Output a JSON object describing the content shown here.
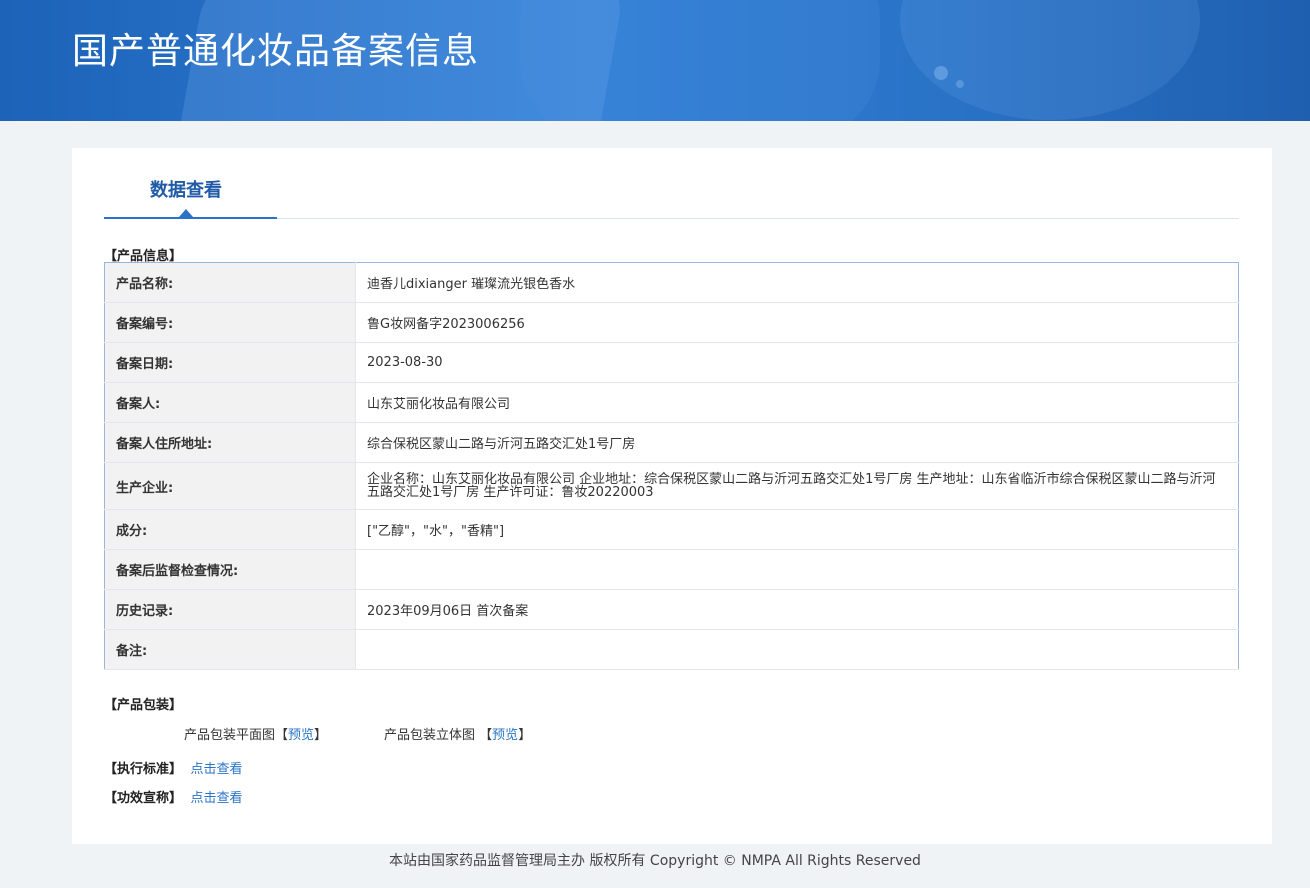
{
  "banner": {
    "title": "国产普通化妆品备案信息"
  },
  "tabs": [
    {
      "label": "数据查看"
    }
  ],
  "product_info": {
    "section_label": "【产品信息】",
    "rows": [
      {
        "key": "产品名称:",
        "value": "迪香儿dixianger 璀璨流光银色香水"
      },
      {
        "key": "备案编号:",
        "value": "鲁G妆网备字2023006256"
      },
      {
        "key": "备案日期:",
        "value": "2023-08-30"
      },
      {
        "key": "备案人:",
        "value": "山东艾丽化妆品有限公司"
      },
      {
        "key": "备案人住所地址:",
        "value": "综合保税区蒙山二路与沂河五路交汇处1号厂房"
      },
      {
        "key": "生产企业:",
        "value": "企业名称：山东艾丽化妆品有限公司 企业地址：综合保税区蒙山二路与沂河五路交汇处1号厂房 生产地址：山东省临沂市综合保税区蒙山二路与沂河五路交汇处1号厂房 生产许可证：鲁妆20220003"
      },
      {
        "key": "成分:",
        "value": "[\"乙醇\"，\"水\"，\"香精\"]"
      },
      {
        "key": "备案后监督检查情况:",
        "value": ""
      },
      {
        "key": "历史记录:",
        "value": "2023年09月06日 首次备案"
      },
      {
        "key": "备注:",
        "value": ""
      }
    ]
  },
  "packaging": {
    "section_label": "【产品包装】",
    "flat_label": "产品包装平面图",
    "flat_preview": "预览",
    "solid_label": "产品包装立体图",
    "solid_preview": "预览",
    "bracket_open": "【",
    "bracket_close": "】"
  },
  "standard": {
    "label": "【执行标准】",
    "link": "点击查看"
  },
  "efficacy": {
    "label": "【功效宣称】",
    "link": "点击查看"
  },
  "footer": {
    "text": "本站由国家药品监督管理局主办 版权所有 Copyright © NMPA All Rights Reserved"
  }
}
